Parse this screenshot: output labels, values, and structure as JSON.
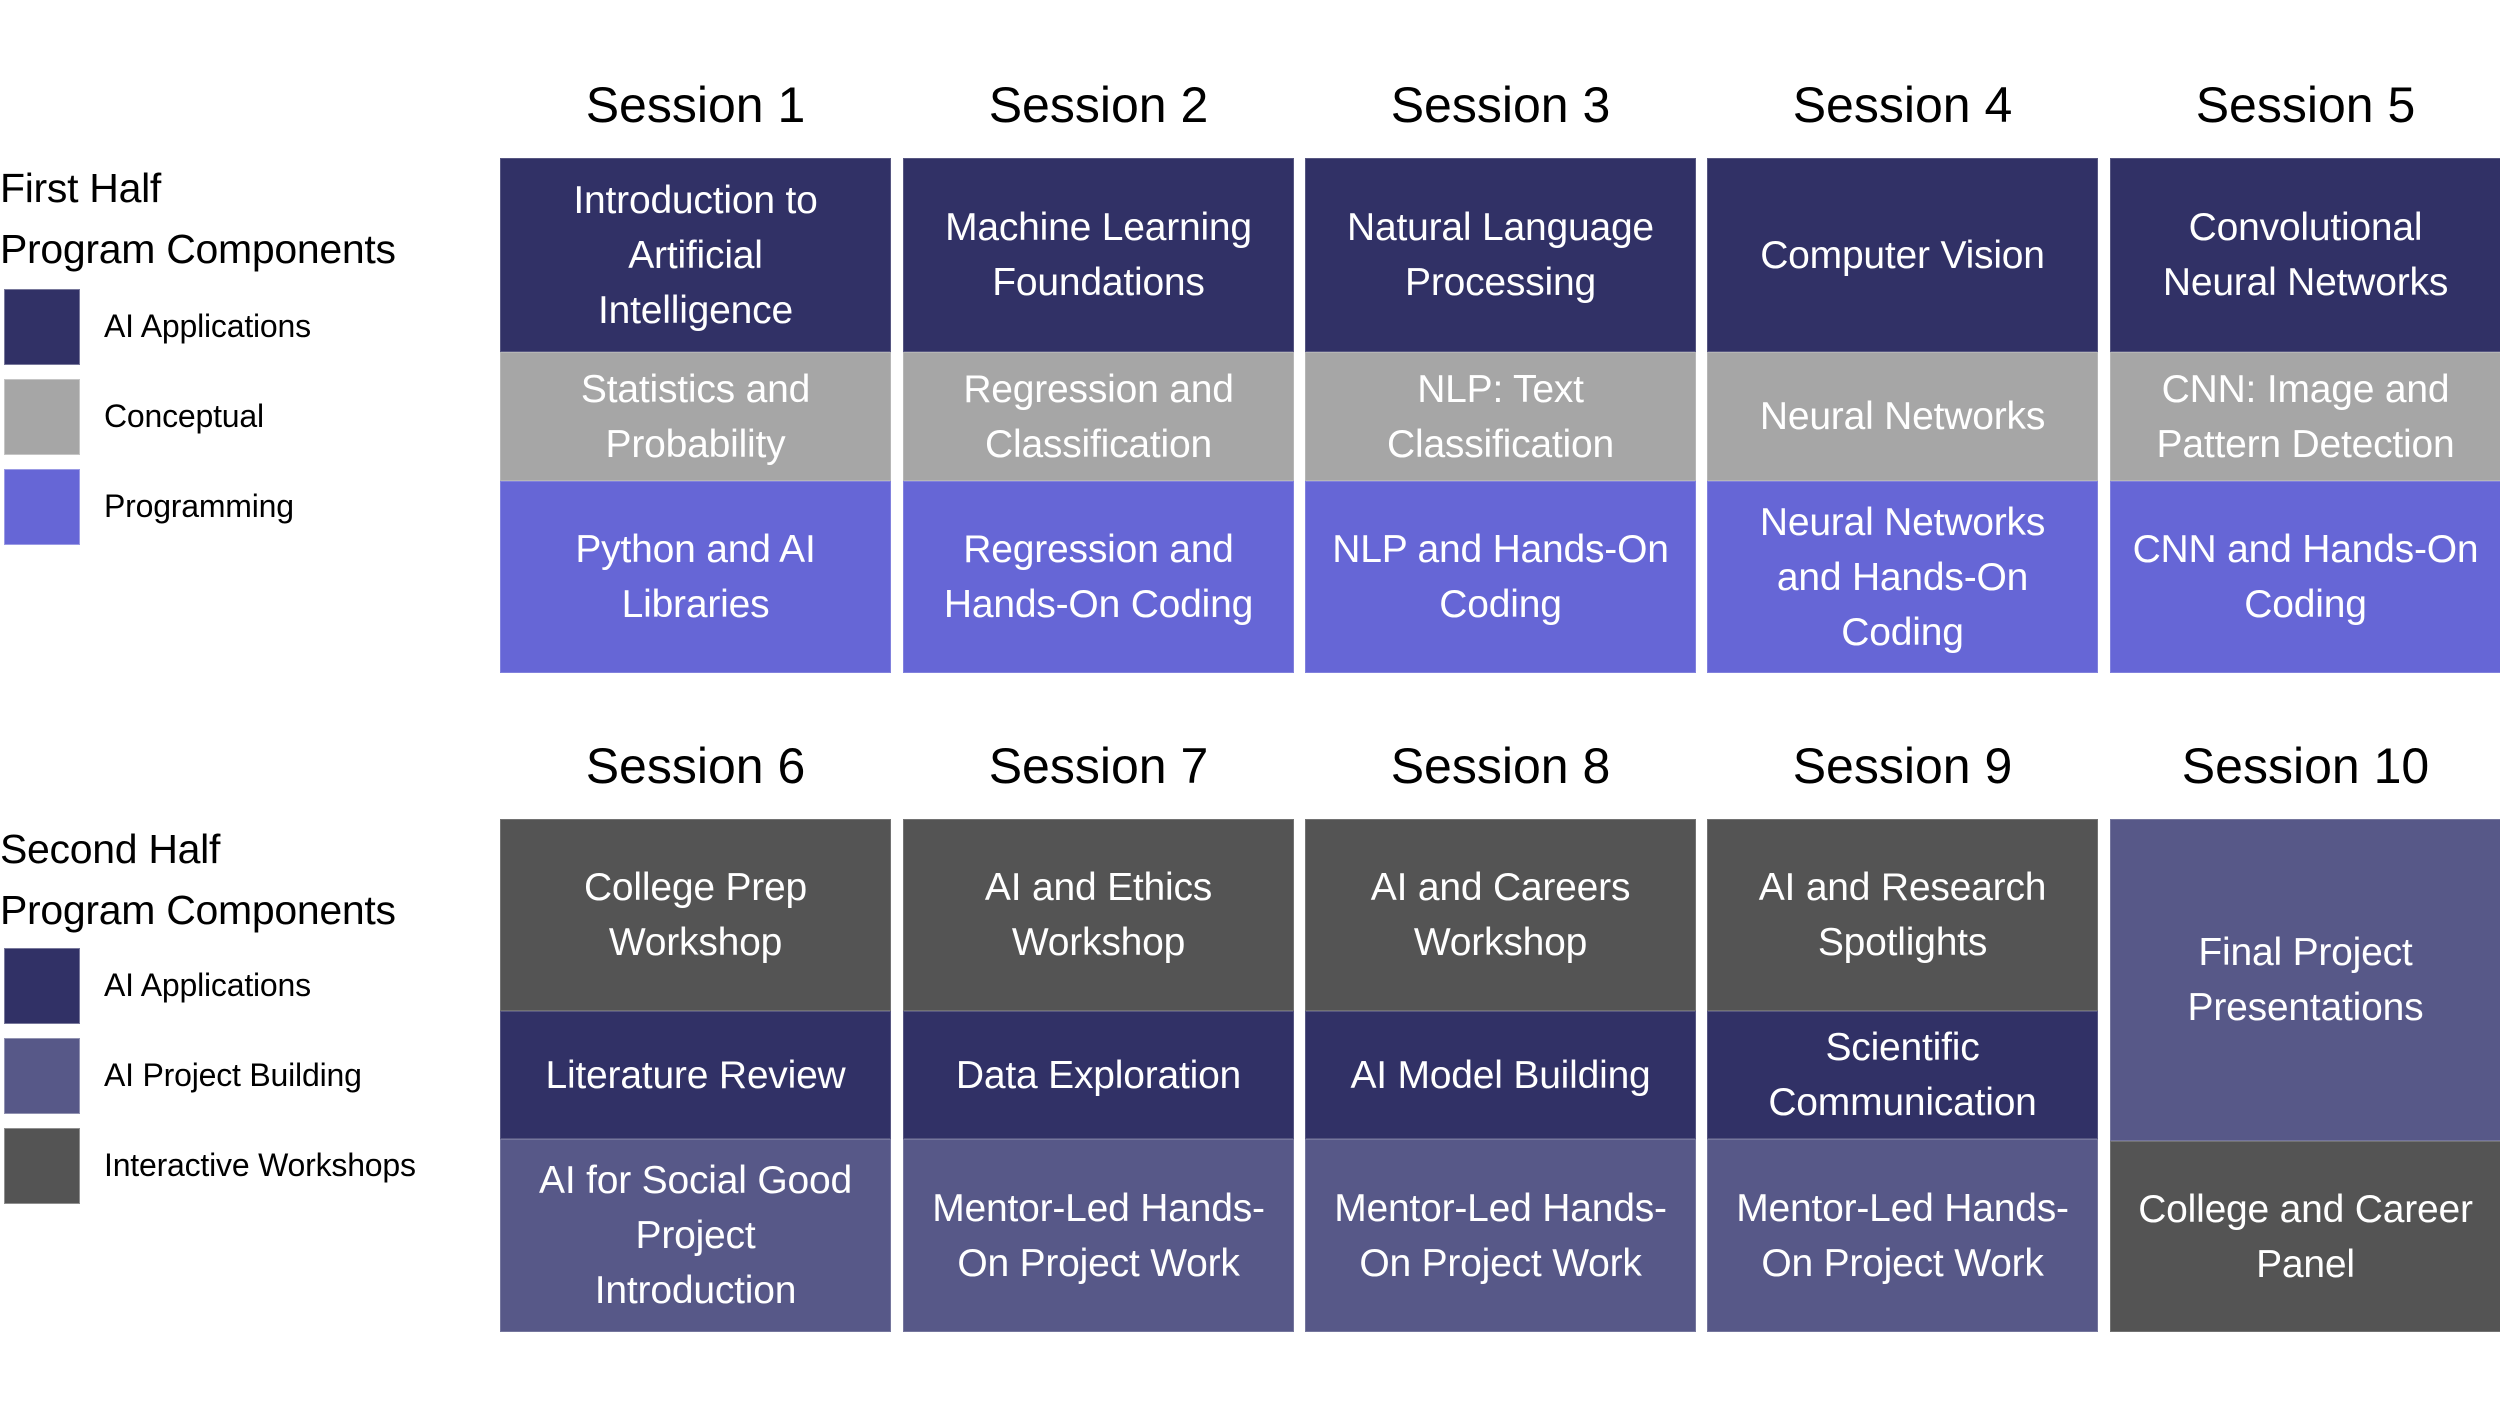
{
  "colors": {
    "ai_applications": "#313166",
    "conceptual": "#a6a6a6",
    "programming": "#6666d6",
    "ai_project_building": "#575888",
    "interactive_workshops": "#545454"
  },
  "first_half": {
    "legend": {
      "title_line1": "First Half",
      "title_line2": "Program Components",
      "items": [
        {
          "label": "AI Applications",
          "color": "#313166"
        },
        {
          "label": "Conceptual",
          "color": "#a6a6a6"
        },
        {
          "label": "Programming",
          "color": "#6666d6"
        }
      ]
    },
    "sessions": [
      {
        "title": "Session 1",
        "cells": [
          {
            "category": "AI Applications",
            "text": "Introduction to Artificial Intelligence",
            "lines": [
              "Introduction to",
              "Artificial",
              "Intelligence"
            ]
          },
          {
            "category": "Conceptual",
            "text": "Statistics and Probability",
            "lines": [
              "Statistics and",
              "Probability"
            ]
          },
          {
            "category": "Programming",
            "text": "Python and AI Libraries",
            "lines": [
              "Python and AI",
              "Libraries"
            ]
          }
        ]
      },
      {
        "title": "Session 2",
        "cells": [
          {
            "category": "AI Applications",
            "text": "Machine Learning Foundations",
            "lines": [
              "Machine Learning",
              "Foundations"
            ]
          },
          {
            "category": "Conceptual",
            "text": "Regression and Classification",
            "lines": [
              "Regression and",
              "Classification"
            ]
          },
          {
            "category": "Programming",
            "text": "Regression and Hands-On Coding",
            "lines": [
              "Regression and",
              "Hands-On Coding"
            ]
          }
        ]
      },
      {
        "title": "Session 3",
        "cells": [
          {
            "category": "AI Applications",
            "text": "Natural Language Processing",
            "lines": [
              "Natural Language",
              "Processing"
            ]
          },
          {
            "category": "Conceptual",
            "text": "NLP: Text Classification",
            "lines": [
              "NLP: Text",
              "Classification"
            ]
          },
          {
            "category": "Programming",
            "text": "NLP and Hands-On Coding",
            "lines": [
              "NLP and Hands-On",
              "Coding"
            ]
          }
        ]
      },
      {
        "title": "Session 4",
        "cells": [
          {
            "category": "AI Applications",
            "text": "Computer Vision",
            "lines": [
              "Computer Vision"
            ]
          },
          {
            "category": "Conceptual",
            "text": "Neural Networks",
            "lines": [
              "Neural Networks"
            ]
          },
          {
            "category": "Programming",
            "text": "Neural Networks and Hands-On Coding",
            "lines": [
              "Neural Networks",
              "and Hands-On",
              "Coding"
            ]
          }
        ]
      },
      {
        "title": "Session 5",
        "cells": [
          {
            "category": "AI Applications",
            "text": "Convolutional Neural Networks",
            "lines": [
              "Convolutional",
              "Neural Networks"
            ]
          },
          {
            "category": "Conceptual",
            "text": "CNN: Image and Pattern Detection",
            "lines": [
              "CNN: Image and",
              "Pattern Detection"
            ]
          },
          {
            "category": "Programming",
            "text": "CNN and Hands-On Coding",
            "lines": [
              "CNN and Hands-On",
              "Coding"
            ]
          }
        ]
      }
    ]
  },
  "second_half": {
    "legend": {
      "title_line1": "Second Half",
      "title_line2": "Program Components",
      "items": [
        {
          "label": "AI Applications",
          "color": "#313166"
        },
        {
          "label": "AI Project Building",
          "color": "#575888"
        },
        {
          "label": "Interactive Workshops",
          "color": "#545454"
        }
      ]
    },
    "sessions": [
      {
        "title": "Session 6",
        "cells": [
          {
            "category": "Interactive Workshops",
            "text": "College Prep Workshop",
            "lines": [
              "College Prep",
              "Workshop"
            ]
          },
          {
            "category": "AI Applications",
            "text": "Literature Review",
            "lines": [
              "Literature Review"
            ]
          },
          {
            "category": "AI Project Building",
            "text": "AI for Social Good Project Introduction",
            "lines": [
              "AI for Social Good",
              "Project",
              "Introduction"
            ]
          }
        ]
      },
      {
        "title": "Session 7",
        "cells": [
          {
            "category": "Interactive Workshops",
            "text": "AI and Ethics Workshop",
            "lines": [
              "AI and Ethics",
              "Workshop"
            ]
          },
          {
            "category": "AI Applications",
            "text": "Data Exploration",
            "lines": [
              "Data Exploration"
            ]
          },
          {
            "category": "AI Project Building",
            "text": "Mentor-Led Hands-On Project Work",
            "lines": [
              "Mentor-Led Hands-",
              "On Project Work"
            ]
          }
        ]
      },
      {
        "title": "Session 8",
        "cells": [
          {
            "category": "Interactive Workshops",
            "text": "AI and Careers Workshop",
            "lines": [
              "AI and Careers",
              "Workshop"
            ]
          },
          {
            "category": "AI Applications",
            "text": "AI Model Building",
            "lines": [
              "AI Model Building"
            ]
          },
          {
            "category": "AI Project Building",
            "text": "Mentor-Led Hands-On Project Work",
            "lines": [
              "Mentor-Led Hands-",
              "On Project Work"
            ]
          }
        ]
      },
      {
        "title": "Session 9",
        "cells": [
          {
            "category": "Interactive Workshops",
            "text": "AI and Research Spotlights",
            "lines": [
              "AI and Research",
              "Spotlights"
            ]
          },
          {
            "category": "AI Applications",
            "text": "Scientific Communication",
            "lines": [
              "Scientific",
              "Communication"
            ]
          },
          {
            "category": "AI Project Building",
            "text": "Mentor-Led Hands-On Project Work",
            "lines": [
              "Mentor-Led Hands-",
              "On Project Work"
            ]
          }
        ]
      },
      {
        "title": "Session 10",
        "cells": [
          {
            "category": "AI Project Building",
            "text": "Final Project Presentations",
            "lines": [
              "Final Project",
              "Presentations"
            ]
          },
          {
            "category": "Interactive Workshops",
            "text": "College and Career Panel",
            "lines": [
              "College and Career",
              "Panel"
            ]
          }
        ]
      }
    ]
  }
}
